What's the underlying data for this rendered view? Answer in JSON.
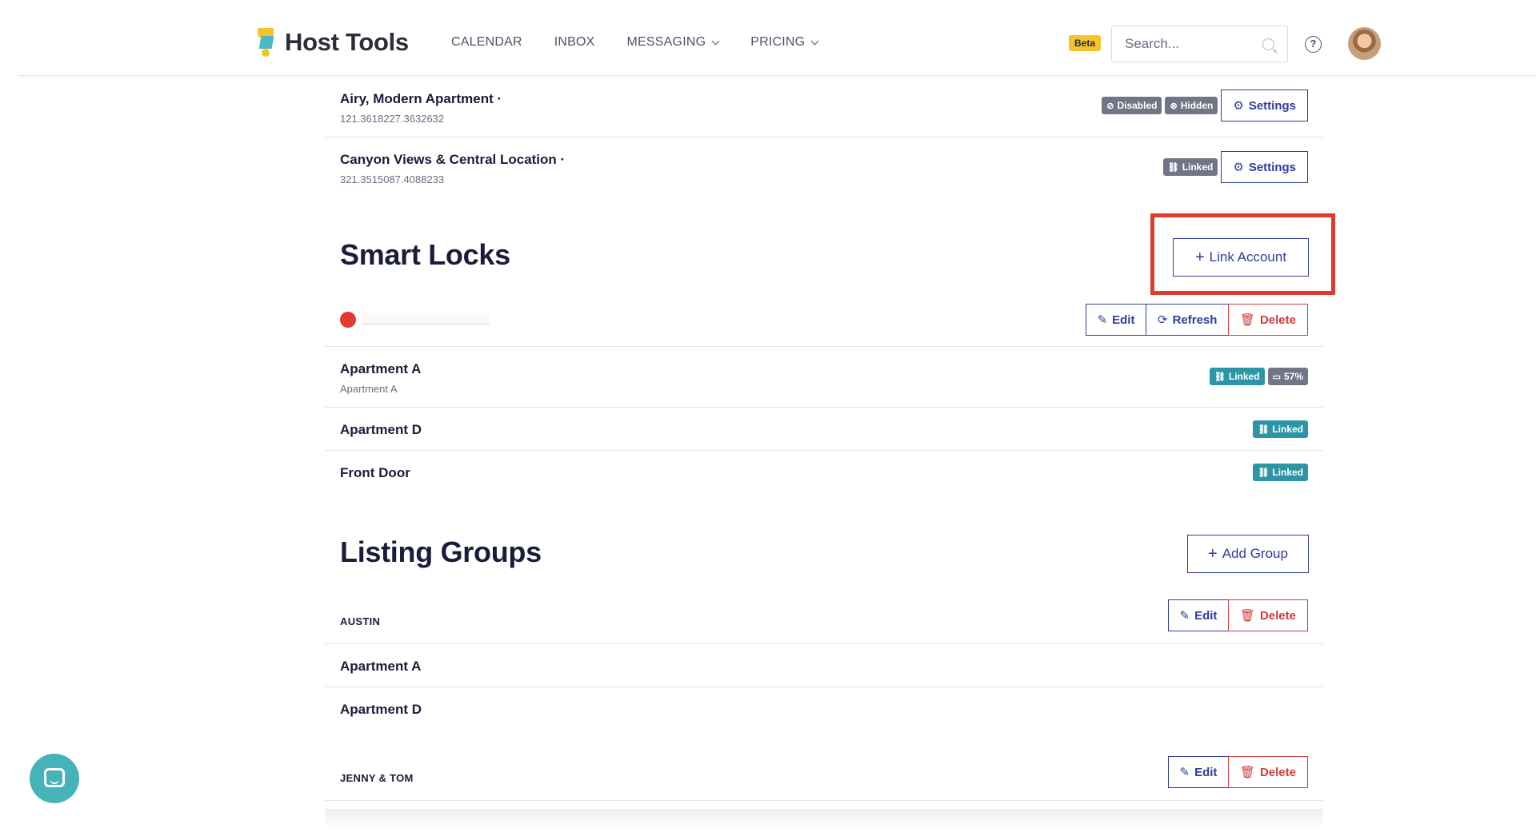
{
  "header": {
    "logo_text": "Host Tools",
    "nav": [
      "CALENDAR",
      "INBOX",
      "MESSAGING",
      "PRICING"
    ],
    "beta": "Beta",
    "search_placeholder": "Search...",
    "help": "?"
  },
  "listings": [
    {
      "title": "Airy, Modern Apartment ·",
      "sub": "121.3618227.3632632",
      "badges": [
        "Disabled",
        "Hidden"
      ],
      "settings": "Settings"
    },
    {
      "title": "Canyon Views & Central Location ·",
      "sub": "321.3515087.4088233",
      "badges": [
        "Linked"
      ],
      "settings": "Settings"
    }
  ],
  "smart_locks": {
    "title": "Smart Locks",
    "link_account": "Link Account",
    "account_actions": {
      "edit": "Edit",
      "refresh": "Refresh",
      "delete": "Delete"
    },
    "locks": [
      {
        "title": "Apartment A",
        "sub": "Apartment A",
        "linked": "Linked",
        "battery": "57%"
      },
      {
        "title": "Apartment D",
        "linked": "Linked"
      },
      {
        "title": "Front Door",
        "linked": "Linked"
      }
    ]
  },
  "listing_groups": {
    "title": "Listing Groups",
    "add_group": "Add Group",
    "groups": [
      {
        "name": "AUSTIN",
        "edit": "Edit",
        "delete": "Delete",
        "items": [
          "Apartment A",
          "Apartment D"
        ]
      },
      {
        "name": "JENNY & TOM",
        "edit": "Edit",
        "delete": "Delete",
        "items": []
      }
    ]
  },
  "colors": {
    "accent": "#2f3c9a",
    "danger": "#d13c3c",
    "linked": "#2d96a6",
    "brand_yellow": "#f4c42a",
    "highlight": "#e03a31"
  }
}
